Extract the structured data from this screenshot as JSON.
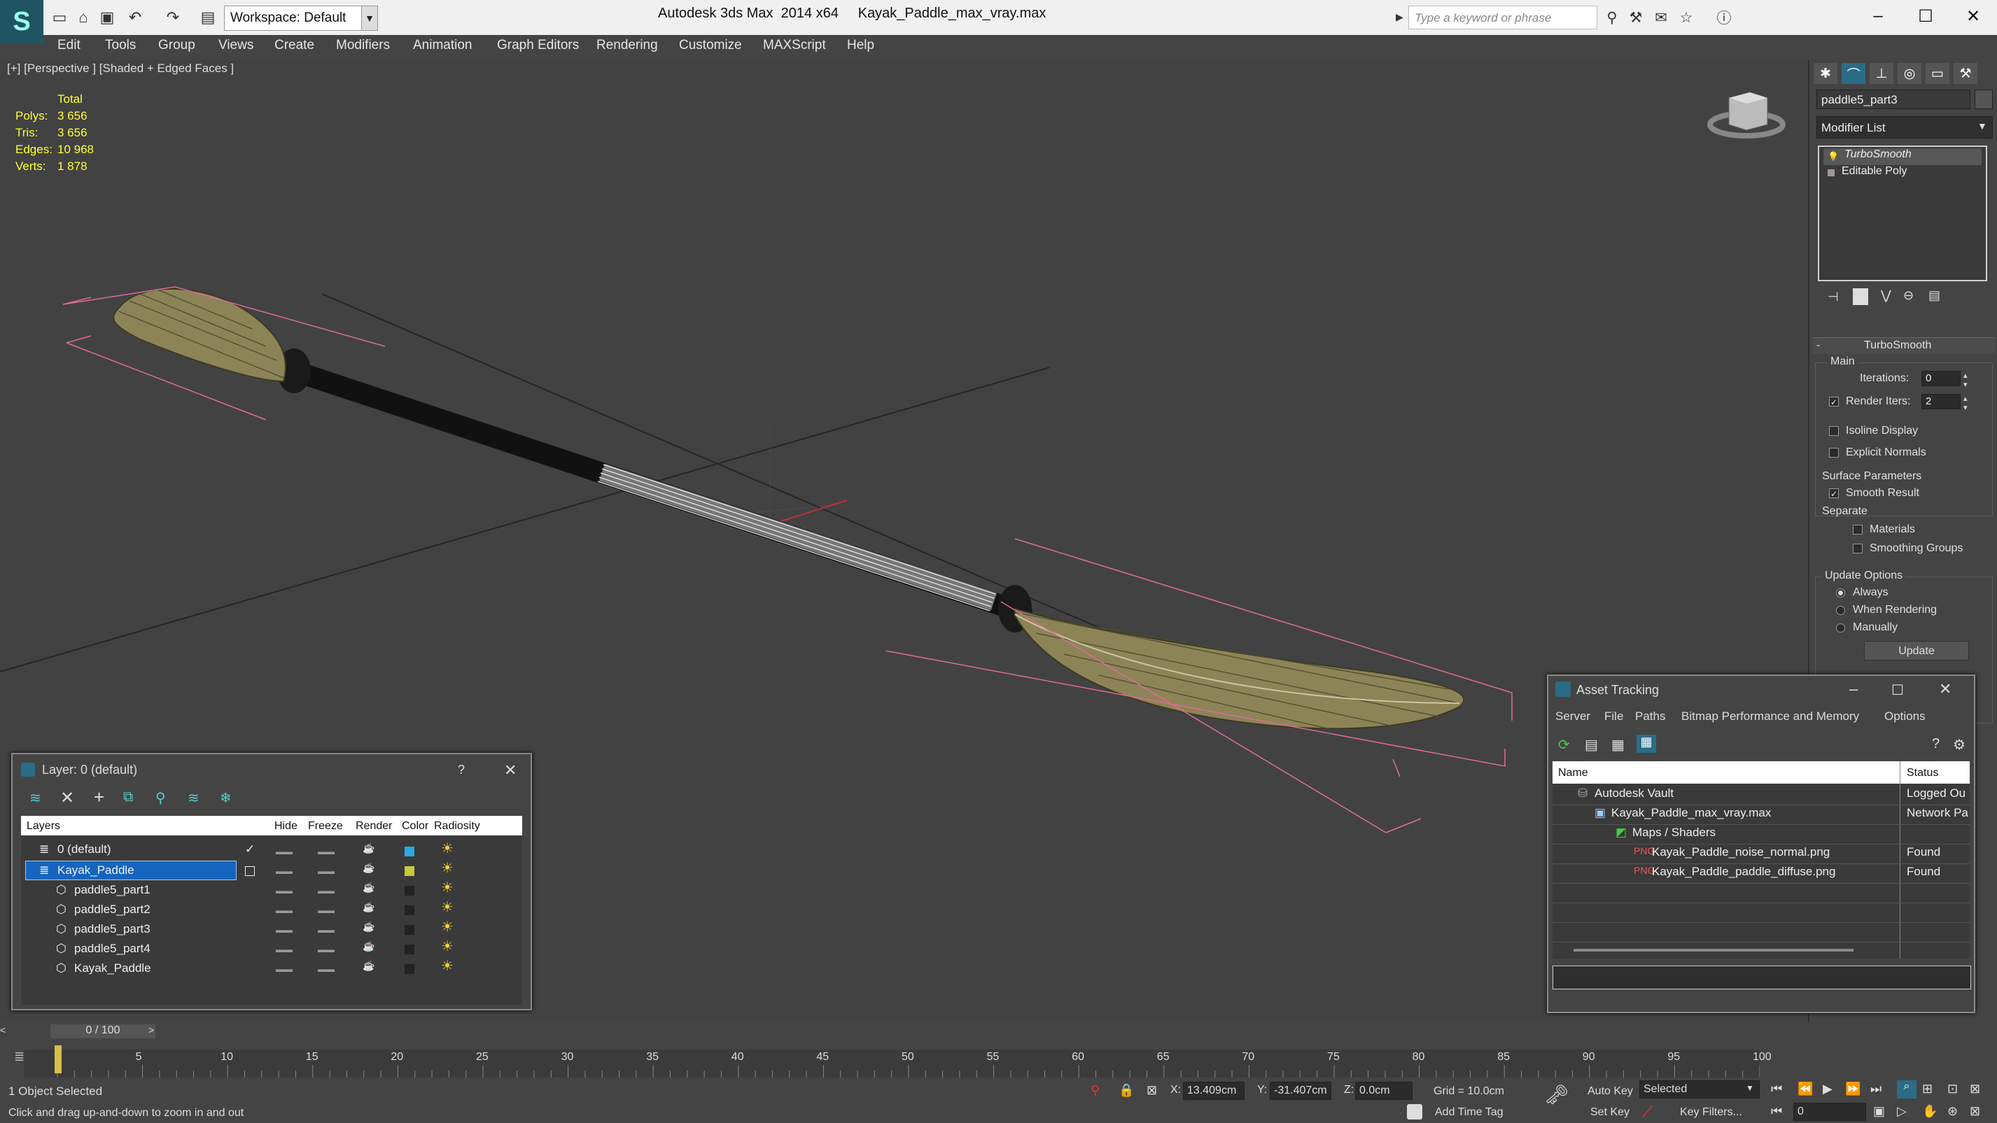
{
  "app": {
    "logo": "3ds-max-logo",
    "title": "Autodesk 3ds Max  2014 x64     Kayak_Paddle_max_vray.max",
    "workspace": "Workspace: Default",
    "search_placeholder": "Type a keyword or phrase",
    "window_controls": [
      "minimize",
      "maximize",
      "close"
    ]
  },
  "menu": [
    "Edit",
    "Tools",
    "Group",
    "Views",
    "Create",
    "Modifiers",
    "Animation",
    "Graph Editors",
    "Rendering",
    "Customize",
    "MAXScript",
    "Help"
  ],
  "viewport": {
    "label": "[+] [Perspective ] [Shaded + Edged Faces ]",
    "stats": {
      "header": "Total",
      "rows": [
        {
          "label": "Polys:",
          "value": "3 656"
        },
        {
          "label": "Tris:",
          "value": "3 656"
        },
        {
          "label": "Edges:",
          "value": "10 968"
        },
        {
          "label": "Verts:",
          "value": "1 878"
        }
      ]
    }
  },
  "command_panel": {
    "object_name": "paddle5_part3",
    "modifier_list": "Modifier List",
    "stack": [
      "TurboSmooth",
      "Editable Poly"
    ],
    "rollout_title": "TurboSmooth",
    "main_label": "Main",
    "iterations_label": "Iterations:",
    "iterations_value": "0",
    "render_iters_label": "Render Iters:",
    "render_iters_value": "2",
    "render_iters_checked": true,
    "isoline_label": "Isoline Display",
    "explicit_normals_label": "Explicit Normals",
    "surface_params_label": "Surface Parameters",
    "smooth_result_label": "Smooth Result",
    "separate_label": "Separate",
    "materials_label": "Materials",
    "smoothing_groups_label": "Smoothing Groups",
    "update_options_label": "Update Options",
    "always_label": "Always",
    "when_rendering_label": "When Rendering",
    "manually_label": "Manually",
    "update_button": "Update"
  },
  "layer_panel": {
    "title": "Layer: 0 (default)",
    "help": "?",
    "columns": [
      "Layers",
      "Hide",
      "Freeze",
      "Render",
      "Color",
      "Radiosity"
    ],
    "rows": [
      {
        "name": "0 (default)",
        "color": "#29a9e0",
        "level": 0
      },
      {
        "name": "Kayak_Paddle",
        "color": "#c8c83a",
        "level": 0,
        "selected": true
      },
      {
        "name": "paddle5_part1",
        "color": "#222222",
        "level": 1
      },
      {
        "name": "paddle5_part2",
        "color": "#222222",
        "level": 1
      },
      {
        "name": "paddle5_part3",
        "color": "#222222",
        "level": 1
      },
      {
        "name": "paddle5_part4",
        "color": "#222222",
        "level": 1
      },
      {
        "name": "Kayak_Paddle",
        "color": "#222222",
        "level": 1
      }
    ]
  },
  "asset_tracking": {
    "title": "Asset Tracking",
    "menu": [
      "Server",
      "File",
      "Paths",
      "Bitmap Performance and Memory",
      "Options"
    ],
    "columns": [
      "Name",
      "Status"
    ],
    "rows": [
      {
        "name": "Autodesk Vault",
        "status": "Logged Ou",
        "level": 0
      },
      {
        "name": "Kayak_Paddle_max_vray.max",
        "status": "Network Pa",
        "level": 1
      },
      {
        "name": "Maps / Shaders",
        "status": "",
        "level": 2
      },
      {
        "name": "Kayak_Paddle_noise_normal.png",
        "status": "Found",
        "level": 3
      },
      {
        "name": "Kayak_Paddle_paddle_diffuse.png",
        "status": "Found",
        "level": 3
      }
    ]
  },
  "timeline": {
    "slider_label": "0 / 100",
    "ticks": [
      "5",
      "10",
      "15",
      "20",
      "25",
      "30",
      "35",
      "40",
      "45",
      "50",
      "55",
      "60",
      "65",
      "70",
      "75",
      "80",
      "85",
      "90",
      "95",
      "100"
    ]
  },
  "status_bar": {
    "selection": "1 Object Selected",
    "prompt": "Click and drag up-and-down to zoom in and out",
    "x_label": "X:",
    "x_value": "13.409cm",
    "y_label": "Y:",
    "y_value": "-31.407cm",
    "z_label": "Z:",
    "z_value": "0.0cm",
    "grid": "Grid = 10.0cm",
    "add_time_tag": "Add Time Tag",
    "auto_key": "Auto Key",
    "set_key": "Set Key",
    "selected_dropdown": "Selected",
    "key_filters": "Key Filters...",
    "frame_value": "0"
  }
}
